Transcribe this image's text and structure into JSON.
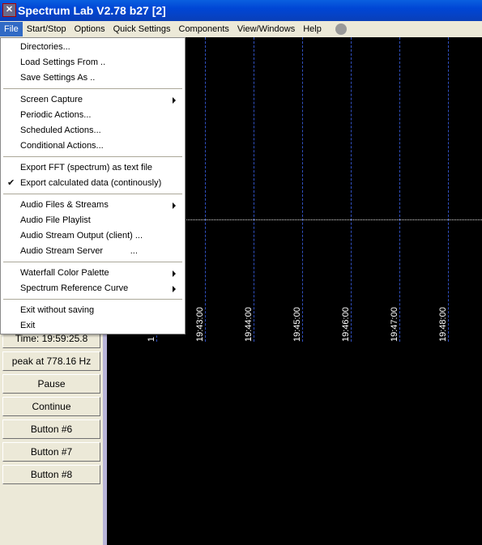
{
  "window": {
    "title": "Spectrum Lab V2.78 b27 [2]"
  },
  "menubar": [
    "File",
    "Start/Stop",
    "Options",
    "Quick Settings",
    "Components",
    "View/Windows",
    "Help"
  ],
  "file_menu": [
    {
      "label": "Directories...",
      "y": 0
    },
    {
      "label": "Load Settings From ..",
      "y": 0
    },
    {
      "label": "Save Settings As ..",
      "y": 0
    },
    {
      "label": "Screen Capture",
      "submenu": true
    },
    {
      "label": "Periodic Actions..."
    },
    {
      "label": "Scheduled Actions..."
    },
    {
      "label": "Conditional Actions..."
    },
    {
      "label": "Export FFT (spectrum) as text file"
    },
    {
      "label": "Export calculated data (continously)",
      "checked": true
    },
    {
      "label": "Audio Files & Streams",
      "submenu": true
    },
    {
      "label": "Audio File Playlist"
    },
    {
      "label": "Audio Stream Output (client) ..."
    },
    {
      "label": "Audio Stream Server           ..."
    },
    {
      "label": "Waterfall Color Palette",
      "submenu": true
    },
    {
      "label": "Spectrum Reference Curve",
      "submenu": true
    },
    {
      "label": "Exit without saving"
    },
    {
      "label": "Exit"
    }
  ],
  "buttons": [
    "Time:  19:59:25.8",
    "peak at 778.16 Hz",
    "Pause",
    "Continue",
    "Button #6",
    "Button #7",
    "Button #8"
  ],
  "time_labels": [
    "1",
    "19:43:00",
    "19:44:00",
    "19:45:00",
    "19:46:00",
    "19:47:00",
    "19:48:00"
  ]
}
